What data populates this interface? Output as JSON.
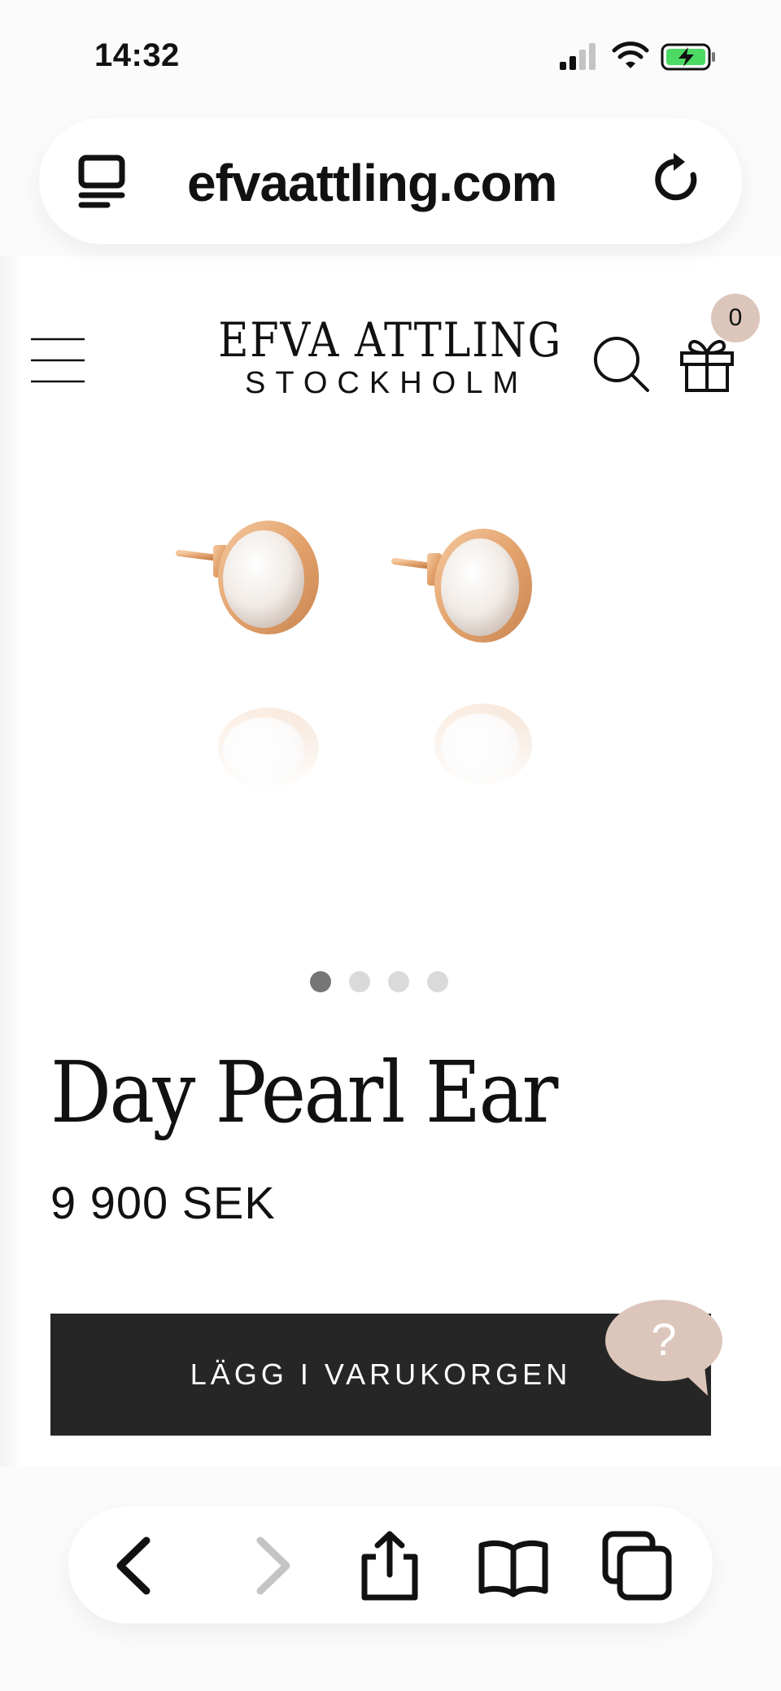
{
  "status_bar": {
    "time": "14:32",
    "battery_state": "charging",
    "accent": "#4cd964"
  },
  "browser": {
    "url": "efvaattling.com",
    "reader_icon": "reader-mode-icon",
    "reload_icon": "reload-icon"
  },
  "header": {
    "brand_name": "EFVA ATTLING",
    "brand_city": "STOCKHOLM",
    "cart_count": "0",
    "badge_color": "#dcc6bb"
  },
  "product": {
    "title": "Day Pearl Ear",
    "price": "9 900 SEK",
    "add_to_cart_label": "LÄGG I VARUKORGEN",
    "image_count": 4,
    "active_image": 1,
    "button_color": "#262626"
  },
  "help": {
    "label": "?",
    "color": "#dcc6bb"
  },
  "toolbar": {
    "items": [
      "back",
      "forward",
      "share",
      "bookmarks",
      "tabs"
    ],
    "forward_enabled": false
  }
}
